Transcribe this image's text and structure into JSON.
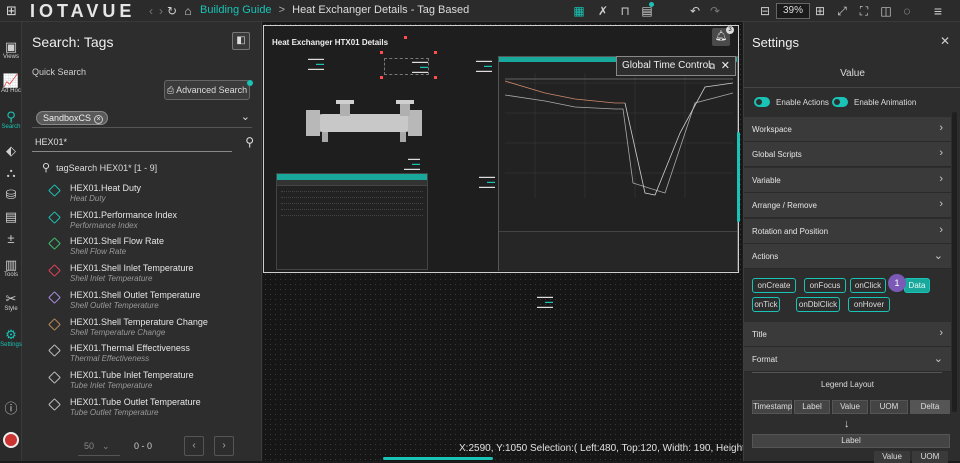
{
  "app": {
    "logo": "IOTAVUE",
    "breadcrumb": {
      "home": "Building Guide",
      "sep": ">",
      "current": "Heat Exchanger Details - Tag Based"
    },
    "zoom": "39%"
  },
  "rail": [
    {
      "icon": "views-icon",
      "label": "Views"
    },
    {
      "icon": "adhoc-icon",
      "label": "Ad Hoc"
    },
    {
      "icon": "search-icon",
      "label": "Search"
    },
    {
      "icon": "tag-icon",
      "label": ""
    },
    {
      "icon": "hierarchy-icon",
      "label": ""
    },
    {
      "icon": "database-icon",
      "label": ""
    },
    {
      "icon": "list-icon",
      "label": ""
    },
    {
      "icon": "calc-icon",
      "label": ""
    },
    {
      "icon": "tools-icon",
      "label": "Tools"
    },
    {
      "icon": "style-icon",
      "label": "Style"
    },
    {
      "icon": "settings-icon",
      "label": "Settings"
    }
  ],
  "search_panel": {
    "title": "Search: Tags",
    "quick_search": "Quick Search",
    "advanced_button": "Advanced Search",
    "filter_chip": "SandboxCS",
    "query": "HEX01*",
    "result_header": "tagSearch HEX01* [1 - 9]",
    "results": [
      {
        "name": "HEX01.Heat Duty",
        "desc": "Heat Duty",
        "color": "#19c3b5"
      },
      {
        "name": "HEX01.Performance Index",
        "desc": "Performance Index",
        "color": "#19c3b5"
      },
      {
        "name": "HEX01.Shell Flow Rate",
        "desc": "Shell Flow Rate",
        "color": "#3fbf6f"
      },
      {
        "name": "HEX01.Shell Inlet Temperature",
        "desc": "Shell Inlet Temperature",
        "color": "#e0405a"
      },
      {
        "name": "HEX01.Shell Outlet Temperature",
        "desc": "Shell Outlet Temperature",
        "color": "#a98de0"
      },
      {
        "name": "HEX01.Shell Temperature Change",
        "desc": "Shell Temperature Change",
        "color": "#b88a5a"
      },
      {
        "name": "HEX01.Thermal Effectiveness",
        "desc": "Thermal Effectiveness",
        "color": "#bdbdbd"
      },
      {
        "name": "HEX01.Tube Inlet Temperature",
        "desc": "Tube Inlet Temperature",
        "color": "#bdbdbd"
      },
      {
        "name": "HEX01.Tube Outlet Temperature",
        "desc": "Tube Outlet Temperature",
        "color": "#bdbdbd"
      }
    ],
    "pager": {
      "per_page": "50",
      "range": "0 - 0"
    }
  },
  "canvas": {
    "title": "Heat Exchanger HTX01 Details",
    "global_time_control": "Global Time Control",
    "notif_count": "3",
    "status": "X:2590, Y:1050  Selection:( Left:480, Top:120, Width: 190, Height: 80 )"
  },
  "settings": {
    "title": "Settings",
    "value_label": "Value",
    "enable_actions": "Enable Actions",
    "enable_animation": "Enable Animation",
    "sections": [
      "Workspace",
      "Global Scripts",
      "Variable",
      "Arrange / Remove",
      "Rotation and Position",
      "Actions"
    ],
    "events": [
      "onCreate",
      "onFocus",
      "onClick",
      "Data",
      "onTick",
      "onDblClick",
      "onHover"
    ],
    "step": "1",
    "sections2": [
      "Title",
      "Format"
    ],
    "legend_layout": "Legend Layout",
    "legend_cols": [
      "Timestamp",
      "Label",
      "Value",
      "UOM",
      "Delta"
    ],
    "label_bar": "Label",
    "value_uom": [
      "Value",
      "UOM"
    ]
  }
}
